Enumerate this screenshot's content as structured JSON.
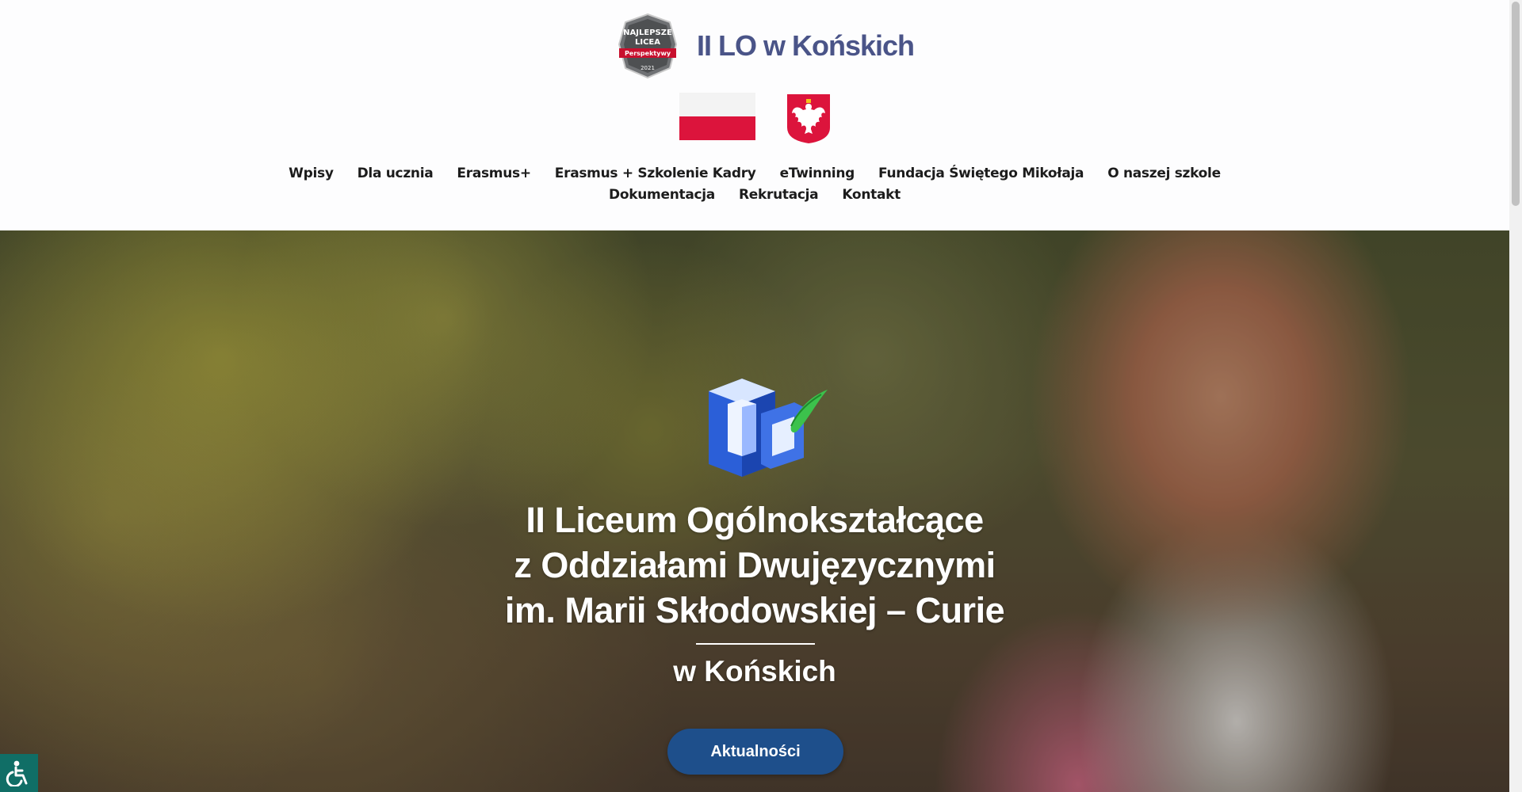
{
  "header": {
    "badge": {
      "line1": "NAJLEPSZE",
      "line2": "LICEA",
      "ribbon": "Perspektywy",
      "year": "2021"
    },
    "site_title": "II LO w Końskich"
  },
  "nav": {
    "row1": [
      "Wpisy",
      "Dla ucznia",
      "Erasmus+",
      "Erasmus + Szkolenie Kadry",
      "eTwinning",
      "Fundacja Świętego Mikołaja",
      "O naszej szkole"
    ],
    "row2": [
      "Dokumentacja",
      "Rekrutacja",
      "Kontakt"
    ]
  },
  "hero": {
    "title_lines": [
      "II Liceum Ogólnokształcące",
      "z Oddziałami Dwujęzycznymi",
      "im. Marii Skłodowskiej – Curie"
    ],
    "subtitle": "w Końskich",
    "button_label": "Aktualności"
  },
  "colors": {
    "title": "#4a5488",
    "flag_red": "#dc143c",
    "button": "#1e4f8b",
    "accessibility": "#106e66"
  },
  "icons": {
    "accessibility": "wheelchair-icon"
  }
}
